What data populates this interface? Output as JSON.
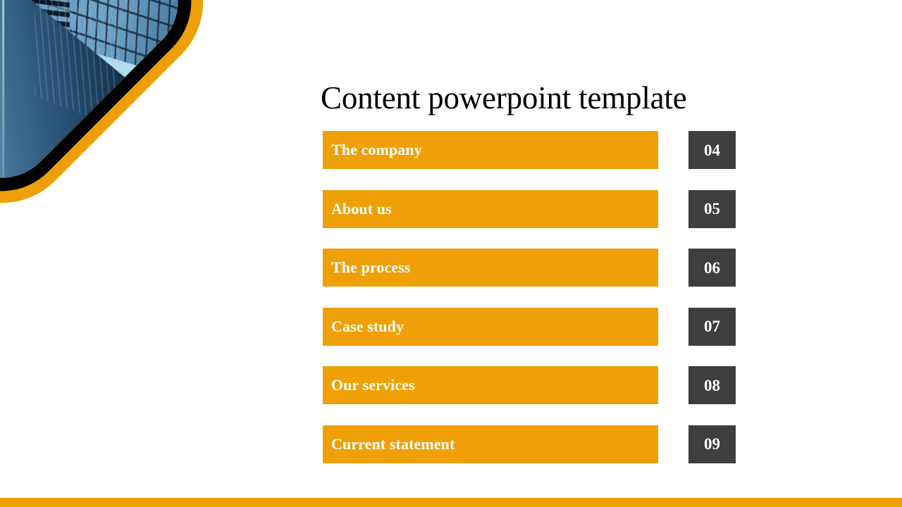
{
  "slide": {
    "title": "Content powerpoint template",
    "background_color": "#ffffff",
    "accent_color": "#efa007",
    "number_box_color": "#3e3e3e",
    "label_text_color": "#ffffff",
    "title_text_color": "#010101"
  },
  "decoration": {
    "name": "rounded-square photo badge",
    "photo_subject": "low-angle view of modern glass office skyscrapers against a blue sky",
    "outer_ring_color": "#efa007",
    "inner_ring_color": "#000000",
    "sky_color": "#9bd2ec",
    "glass_color": "#3d78a8"
  },
  "agenda": {
    "items": [
      {
        "label": "The company",
        "number": "04"
      },
      {
        "label": "About us",
        "number": "05"
      },
      {
        "label": "The process",
        "number": "06"
      },
      {
        "label": "Case study",
        "number": "07"
      },
      {
        "label": "Our services",
        "number": "08"
      },
      {
        "label": "Current statement",
        "number": "09"
      }
    ]
  },
  "footer": {
    "accent_bar_color": "#efa007"
  }
}
